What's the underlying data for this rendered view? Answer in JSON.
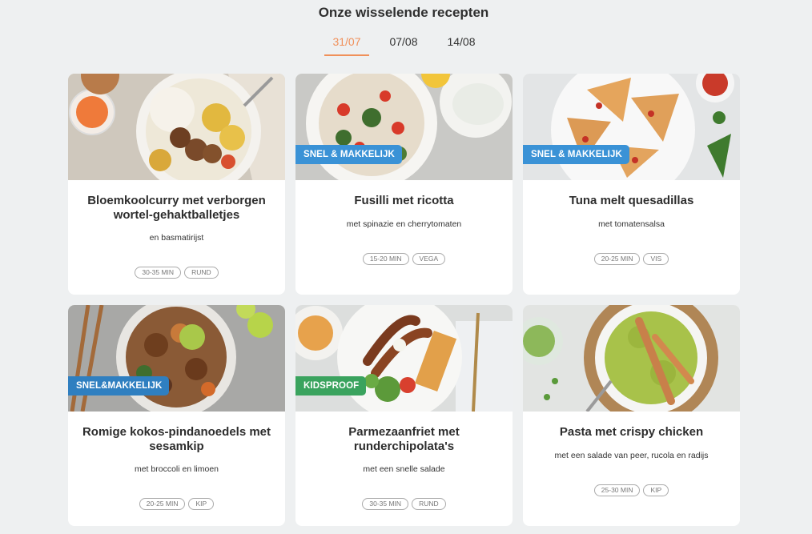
{
  "heading": "Onze wisselende recepten",
  "tabs": [
    {
      "label": "31/07",
      "active": true
    },
    {
      "label": "07/08",
      "active": false
    },
    {
      "label": "14/08",
      "active": false
    }
  ],
  "recipes": [
    {
      "title": "Bloemkoolcurry met verborgen wortel-gehaktballetjes",
      "subtitle": "en basmatirijst",
      "time": "30-35 MIN",
      "category": "RUND",
      "badge": null,
      "image": "cauliflower-curry-bowl"
    },
    {
      "title": "Fusilli met ricotta",
      "subtitle": "met spinazie en cherrytomaten",
      "time": "15-20 MIN",
      "category": "VEGA",
      "badge": "SNEL & MAKKELIJK",
      "image": "fusilli-pasta-plate"
    },
    {
      "title": "Tuna melt quesadillas",
      "subtitle": "met tomatensalsa",
      "time": "20-25 MIN",
      "category": "VIS",
      "badge": "SNEL & MAKKELIJK",
      "image": "quesadilla-plate"
    },
    {
      "title": "Romige kokos-pindanoedels met sesamkip",
      "subtitle": "met broccoli en limoen",
      "time": "20-25 MIN",
      "category": "KIP",
      "badge": "SNEL&MAKKELIJK",
      "image": "noodle-bowl"
    },
    {
      "title": "Parmezaanfriet met runderchipolata's",
      "subtitle": "met een snelle salade",
      "time": "30-35 MIN",
      "category": "RUND",
      "badge": "KIDSPROOF",
      "image": "sausage-fries-plate"
    },
    {
      "title": "Pasta met crispy chicken",
      "subtitle": "met een salade van peer, rucola en radijs",
      "time": "25-30 MIN",
      "category": "KIP",
      "badge": null,
      "image": "pesto-pasta-plate"
    }
  ],
  "colors": {
    "accent": "#f0905a",
    "badge_blue": "#2f7fc0",
    "badge_green": "#3aa35e",
    "background": "#eef0f1"
  }
}
